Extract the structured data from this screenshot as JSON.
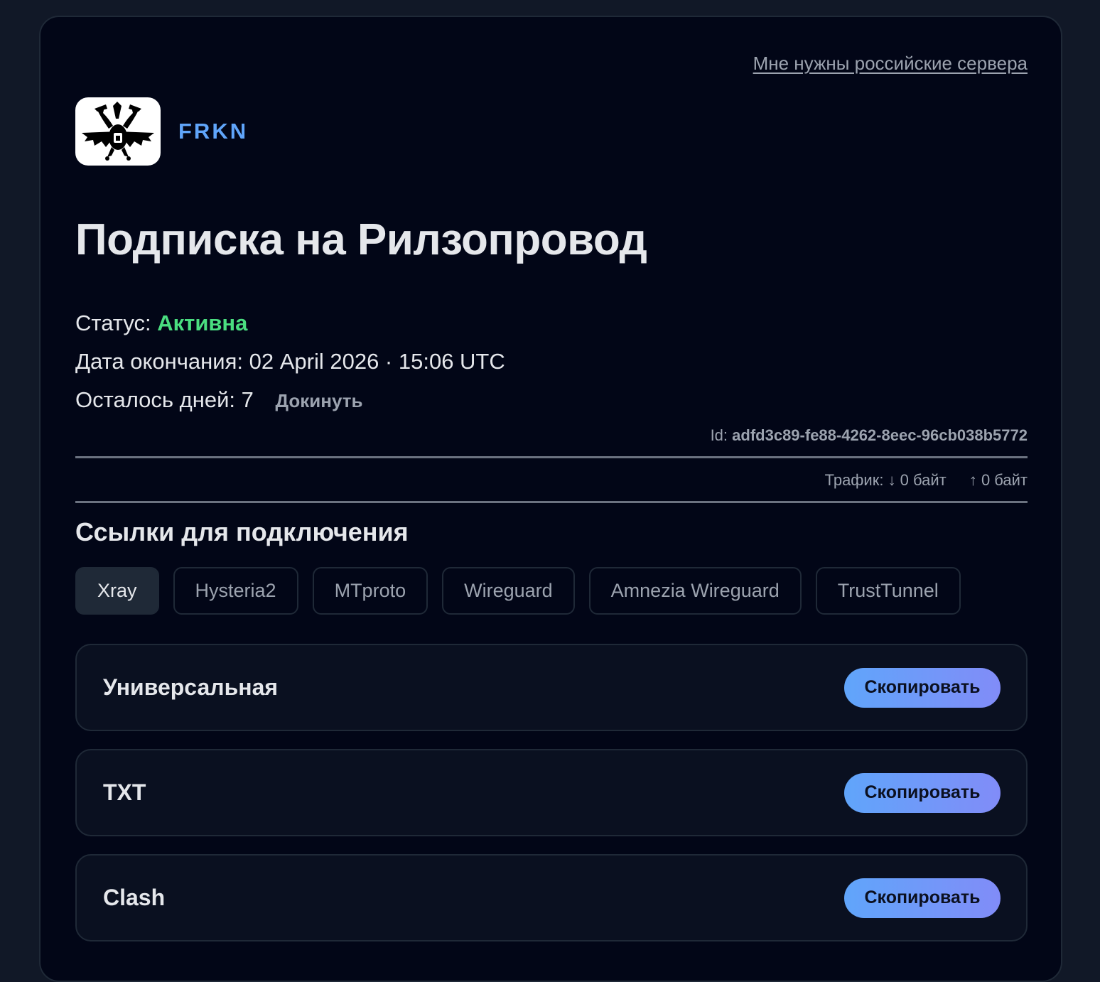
{
  "header": {
    "ru_servers_link": "Мне нужны российские сервера",
    "brand_name": "FRKN",
    "logo_icon": "bat-dragon-logo"
  },
  "subscription": {
    "title": "Подписка на Рилзопровод",
    "status_label": "Статус:",
    "status_value": "Активна",
    "end_date_label": "Дата окончания:",
    "end_date_value": "02 April 2026 · 15:06 UTC",
    "days_left_label": "Осталось дней:",
    "days_left_value": "7",
    "topup_label": "Докинуть",
    "id_label": "Id:",
    "id_value": "adfd3c89-fe88-4262-8eec-96cb038b5772",
    "traffic_label": "Трафик:",
    "traffic_down": "↓ 0 байт",
    "traffic_up": "↑ 0 байт"
  },
  "links": {
    "section_title": "Ссылки для подключения",
    "tabs": [
      {
        "label": "Xray",
        "active": true
      },
      {
        "label": "Hysteria2",
        "active": false
      },
      {
        "label": "MTproto",
        "active": false
      },
      {
        "label": "Wireguard",
        "active": false
      },
      {
        "label": "Amnezia Wireguard",
        "active": false
      },
      {
        "label": "TrustTunnel",
        "active": false
      }
    ],
    "items": [
      {
        "name": "Универсальная",
        "button": "Скопировать"
      },
      {
        "name": "TXT",
        "button": "Скопировать"
      },
      {
        "name": "Clash",
        "button": "Скопировать"
      }
    ]
  },
  "colors": {
    "page_bg": "#111827",
    "card_bg": "#020617",
    "brand": "#60a5fa",
    "status_active": "#4ade80",
    "button_gradient_start": "#60a5fa",
    "button_gradient_end": "#818cf8"
  }
}
